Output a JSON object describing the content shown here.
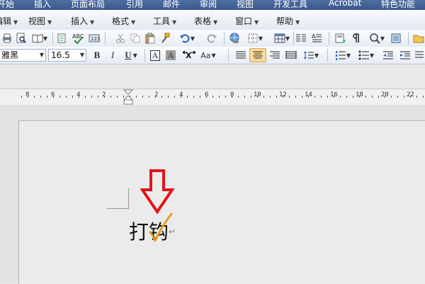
{
  "ribbon_tabs": [
    "开始",
    "插入",
    "页面布局",
    "引用",
    "邮件",
    "审阅",
    "视图",
    "开发工具",
    "Acrobat",
    "特色功能"
  ],
  "menu": [
    "编辑",
    "视图",
    "插入",
    "格式",
    "工具",
    "表格",
    "窗口",
    "帮助"
  ],
  "toolbar_format": {
    "font_name": "雅黑",
    "font_size": "16.5",
    "bold": "B",
    "italic": "I",
    "underline": "U",
    "char_border": "A",
    "char_shading": "A",
    "change_case": "Aa"
  },
  "ruler_numbers": [
    "8",
    "6",
    "4",
    "2",
    "2",
    "4",
    "6",
    "8",
    "10",
    "12",
    "14",
    "16",
    "18",
    "20",
    "22"
  ],
  "document": {
    "text": "打钩",
    "paragraph_mark": "↵"
  },
  "colors": {
    "annotation_arrow": "#e0141c",
    "checkmark": "#e2a21a",
    "alignment_pressed": "#fbd99a"
  }
}
